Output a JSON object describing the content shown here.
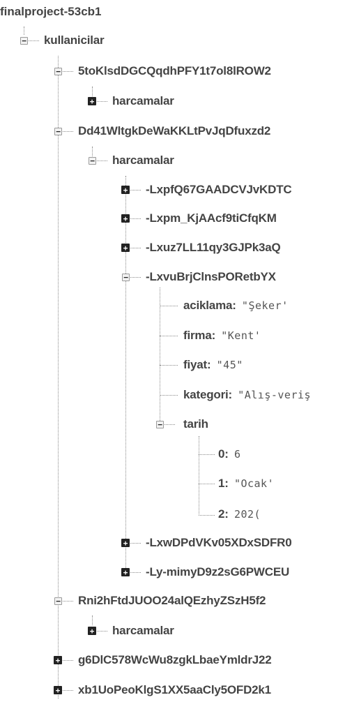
{
  "tree": {
    "root": "finalproject-53cb1",
    "kullanicilar": "kullanicilar",
    "user1": {
      "key": "5toKlsdDGCQqdhPFY1t7ol8lROW2",
      "child": "harcamalar"
    },
    "user2": {
      "key": "Dd41WltgkDeWaKKLtPvJqDfuxzd2",
      "child": "harcamalar",
      "items": {
        "i1": "-LxpfQ67GAADCVJvKDTC",
        "i2": "-Lxpm_KjAAcf9tiCfqKM",
        "i3": "-Lxuz7LL11qy3GJPk3aQ",
        "i4": "-LxvuBrjClnsPORetbYX",
        "i5": "-LxwDPdVKv05XDxSDFR0",
        "i6": "-Ly-mimyD9z2sG6PWCEU"
      },
      "expanded": {
        "aciklama_key": "aciklama",
        "aciklama_val": "\"Şeker'",
        "firma_key": "firma",
        "firma_val": "\"Kent'",
        "fiyat_key": "fiyat",
        "fiyat_val": "\"45\"",
        "kategori_key": "kategori",
        "kategori_val": "\"Alış-veriş",
        "tarih_key": "tarih",
        "t0_key": "0",
        "t0_val": "6",
        "t1_key": "1",
        "t1_val": "\"Ocak'",
        "t2_key": "2",
        "t2_val": "202("
      }
    },
    "user3": {
      "key": "Rni2hFtdJUOO24alQEzhyZSzH5f2",
      "child": "harcamalar"
    },
    "user4": {
      "key": "g6DlC578WcWu8zgkLbaeYmldrJ22"
    },
    "user5": {
      "key": "xb1UoPeoKlgS1XX5aaCly5OFD2k1"
    }
  }
}
